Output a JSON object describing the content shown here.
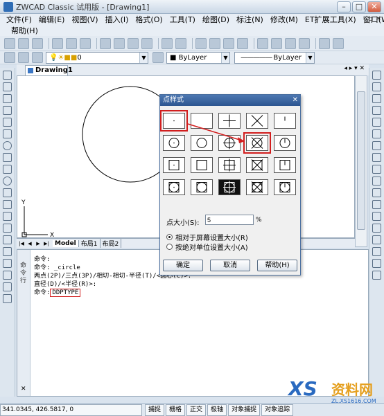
{
  "window": {
    "title": "ZWCAD Classic 试用版 - [Drawing1]",
    "min": "–",
    "max": "□",
    "close": "✕"
  },
  "menu": {
    "items": [
      "文件(F)",
      "编辑(E)",
      "视图(V)",
      "插入(I)",
      "格式(O)",
      "工具(T)",
      "绘图(D)",
      "标注(N)",
      "修改(M)",
      "ET扩展工具(X)",
      "窗口(W)"
    ],
    "help": "帮助(H)",
    "mdi_controls": "– ▫ ✕"
  },
  "properties": {
    "layer": "0",
    "color": "ByLayer",
    "linetype": "ByLayer"
  },
  "drawing": {
    "tab": "Drawing1",
    "tab_controls": "◂ ▸ ▾ ✕",
    "axis_x": "X",
    "axis_y": "Y",
    "layout_tabs": [
      "Model",
      "布局1",
      "布局2"
    ]
  },
  "command": {
    "side_label": "命令行",
    "lines": [
      "命令:",
      "命令: _circle",
      "两点(2P)/三点(3P)/相切-相切-半径(T)/<圆心(C)>:",
      "直径(D)/<半径(R)>:"
    ],
    "prompt": "命令:",
    "input": "DDPTYPE",
    "close": "✕"
  },
  "status": {
    "coords": "341.0345,  426.5817,  0",
    "buttons": [
      "捕捉",
      "栅格",
      "正交",
      "极轴",
      "对象捕捉",
      "对象追踪"
    ]
  },
  "dialog": {
    "title": "点样式",
    "close": "✕",
    "size_label": "点大小(S):",
    "size_value": "5",
    "size_unit": "%",
    "options": [
      "相对于屏幕设置大小(R)",
      "按绝对单位设置大小(A)"
    ],
    "selected_option": 0,
    "buttons": {
      "ok": "确定",
      "cancel": "取消",
      "help": "帮助(H)"
    },
    "point_styles": 20,
    "selected_style": 17
  },
  "watermark": {
    "logo": "XS",
    "text": "资料网",
    "url": "ZL.XS1616.COM"
  }
}
